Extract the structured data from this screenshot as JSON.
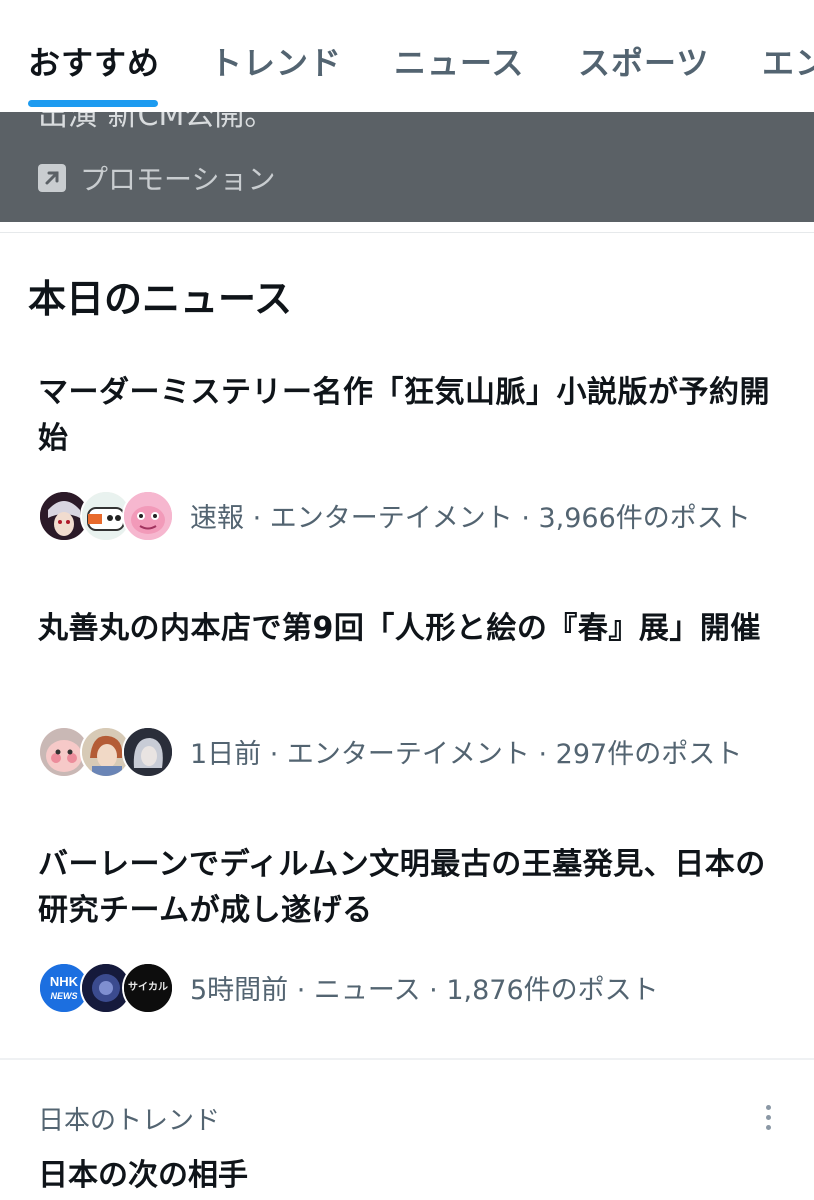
{
  "tabs": [
    {
      "label": "おすすめ",
      "active": true
    },
    {
      "label": "トレンド",
      "active": false
    },
    {
      "label": "ニュース",
      "active": false
    },
    {
      "label": "スポーツ",
      "active": false
    },
    {
      "label": "エン",
      "active": false
    }
  ],
  "promo": {
    "cut_text": "出演 新CM公開。",
    "icon": "promoted-arrow-icon",
    "label": "プロモーション"
  },
  "section": {
    "title": "本日のニュース",
    "items": [
      {
        "headline": "マーダーミステリー名作「狂気山脈」小説版が予約開始",
        "meta": "速報 · エンターテイメント · 3,966件のポスト"
      },
      {
        "headline": "丸善丸の内本店で第9回「人形と絵の『春』展」開催",
        "meta": "1日前 · エンターテイメント · 297件のポスト"
      },
      {
        "headline": "バーレーンでディルムン文明最古の王墓発見、日本の研究チームが成し遂げる",
        "meta": "5時間前 · ニュース · 1,876件のポスト"
      }
    ]
  },
  "avatar_logos": {
    "nhk_top": "NHK",
    "nhk_bottom": "NEWS",
    "third": "サイカル"
  },
  "trend": {
    "label": "日本のトレンド",
    "name": "日本の次の相手",
    "more_icon": "more-vertical-icon"
  },
  "colors": {
    "accent": "#1d9bf0",
    "promo_bg": "#5b6166",
    "secondary_text": "#536471"
  }
}
